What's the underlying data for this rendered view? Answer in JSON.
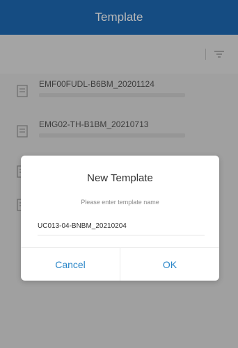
{
  "header": {
    "title": "Template"
  },
  "toolbar": {
    "filter_icon": "filter-icon"
  },
  "list": {
    "items": [
      {
        "title": "EMF00FUDL-B6BM_20201124"
      },
      {
        "title": "EMG02-TH-B1BM_20210713"
      },
      {
        "title": ""
      },
      {
        "title": ""
      }
    ]
  },
  "dialog": {
    "title": "New Template",
    "hint": "Please enter template name",
    "input_value": "UC013-04-BNBM_20210204",
    "cancel_label": "Cancel",
    "ok_label": "OK"
  },
  "colors": {
    "header_bg": "#1e6ab5",
    "button_text": "#2a86c8"
  }
}
